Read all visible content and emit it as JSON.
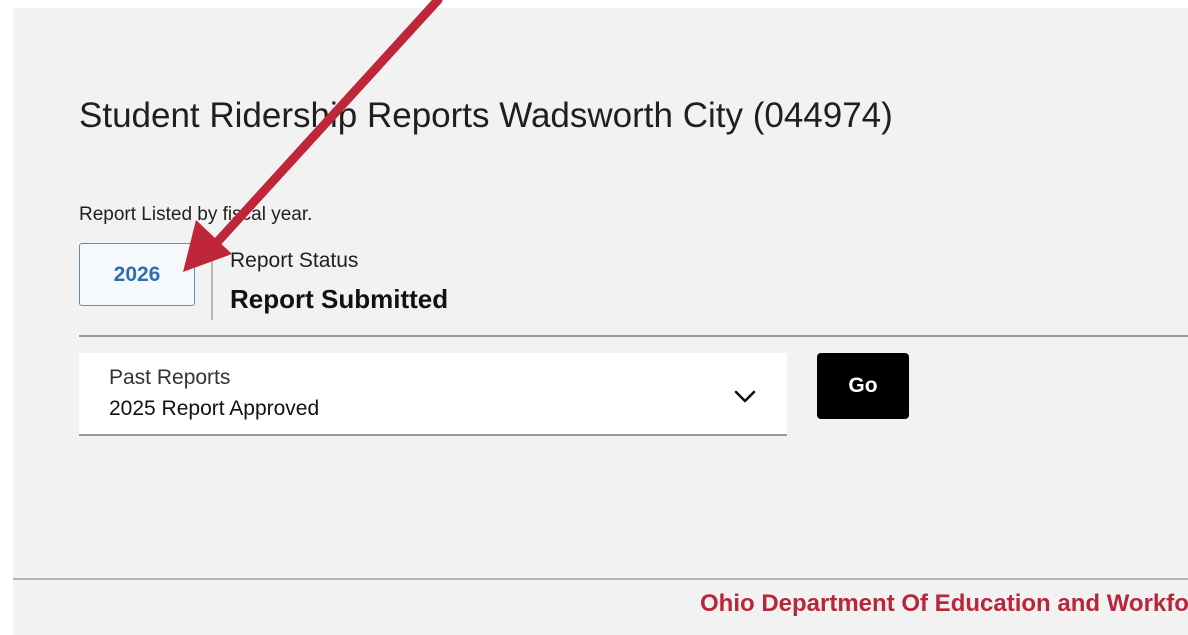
{
  "page": {
    "title": "Student Ridership Reports Wadsworth City (044974)",
    "fiscal_year_note": "Report Listed by fiscal year."
  },
  "current_report": {
    "year_tab_label": "2026",
    "status_label": "Report Status",
    "status_value": "Report Submitted"
  },
  "past_reports": {
    "label": "Past Reports",
    "selected_value": "2025 Report Approved",
    "go_label": "Go"
  },
  "footer": {
    "text": "Ohio Department Of Education and Workforce"
  },
  "colors": {
    "panel_bg": "#f2f2f2",
    "tab_accent": "#2f6fae",
    "footer_text": "#b8263a",
    "annotation_arrow": "#c0263a"
  },
  "icons": {
    "select_chevron": "chevron-down-icon",
    "annotation": "annotation-arrow"
  }
}
